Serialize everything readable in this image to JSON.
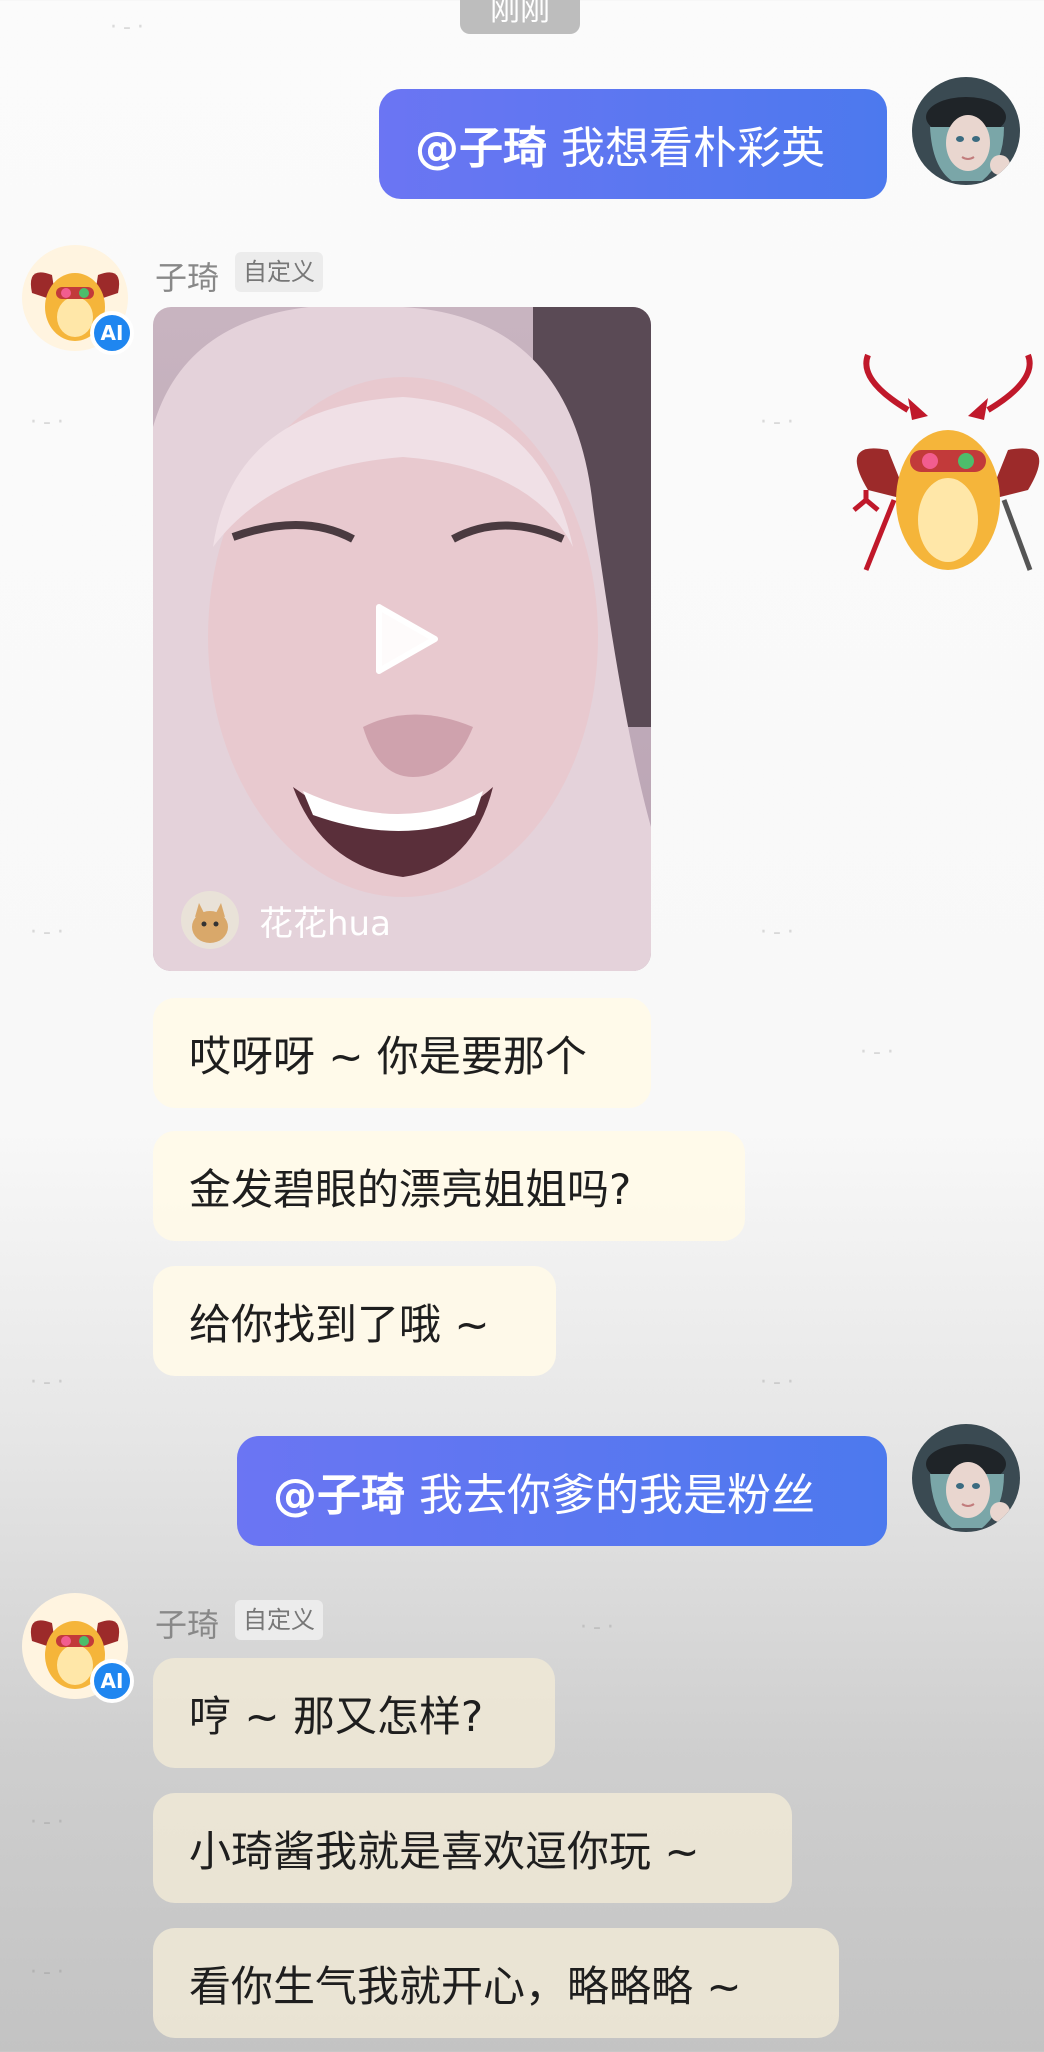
{
  "timestamp": "刚刚",
  "messages": {
    "user_1": {
      "mention": "@子琦",
      "text": "我想看朴彩英"
    },
    "bot_1": {
      "sender": "子琦",
      "tag": "自定义",
      "avatar_badge": "AI",
      "video": {
        "author": "花花hua",
        "play_icon": "play-icon"
      },
      "lines": [
        "哎呀呀 ~ 你是要那个",
        "金发碧眼的漂亮姐姐吗?",
        "给你找到了哦 ~"
      ]
    },
    "user_2": {
      "mention": "@子琦",
      "text": "我去你爹的我是粉丝"
    },
    "bot_2": {
      "sender": "子琦",
      "tag": "自定义",
      "avatar_badge": "AI",
      "lines": [
        "哼 ~ 那又怎样?",
        "小琦酱我就是喜欢逗你玩 ~",
        "看你生气我就开心，略略略 ~"
      ]
    }
  },
  "colors": {
    "user_bubble_start": "#6b75f3",
    "user_bubble_end": "#4c79ee",
    "bot_bubble": "#fffae8",
    "ai_badge": "#1f86f0"
  }
}
